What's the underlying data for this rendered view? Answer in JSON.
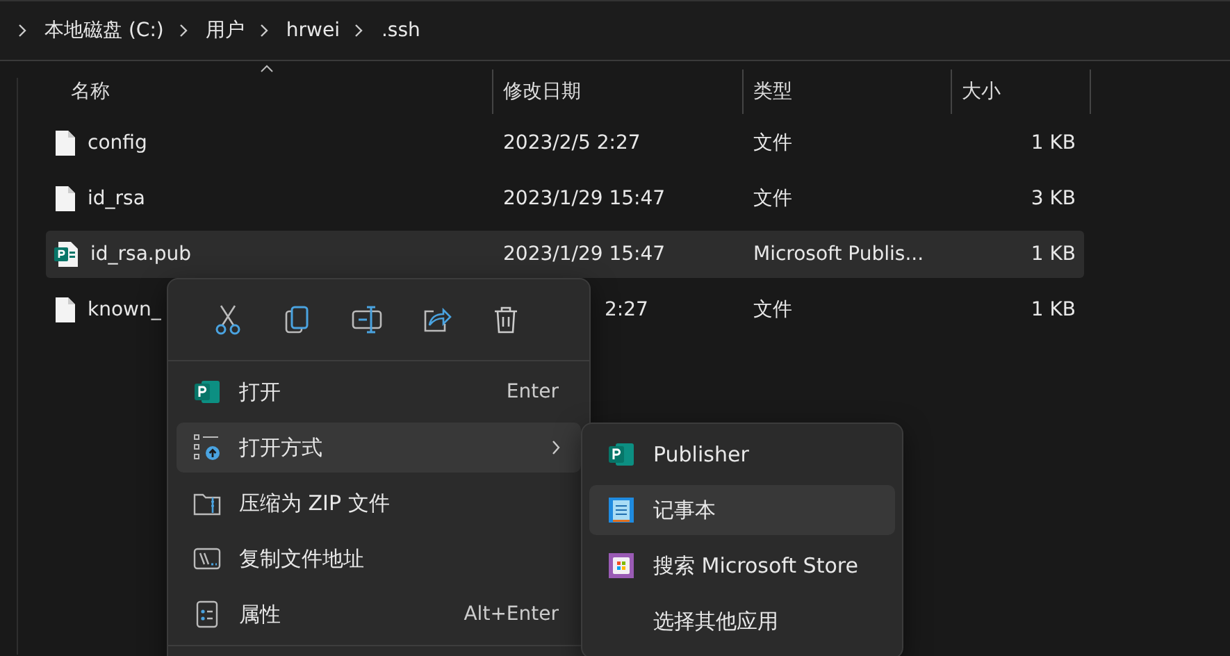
{
  "breadcrumb": [
    "本地磁盘 (C:)",
    "用户",
    "hrwei",
    ".ssh"
  ],
  "columns": [
    {
      "label": "名称",
      "sorted": true
    },
    {
      "label": "修改日期",
      "sorted": false
    },
    {
      "label": "类型",
      "sorted": false
    },
    {
      "label": "大小",
      "sorted": false
    }
  ],
  "rows": [
    {
      "name": "config",
      "date": "2023/2/5 2:27",
      "type": "文件",
      "size": "1 KB",
      "kind": "file",
      "selected": false,
      "covered": false
    },
    {
      "name": "id_rsa",
      "date": "2023/1/29 15:47",
      "type": "文件",
      "size": "3 KB",
      "kind": "file",
      "selected": false,
      "covered": false
    },
    {
      "name": "id_rsa.pub",
      "date": "2023/1/29 15:47",
      "type": "Microsoft Publis...",
      "size": "1 KB",
      "kind": "publisher",
      "selected": true,
      "covered": false
    },
    {
      "name": "known_",
      "date": "2:27",
      "type": "文件",
      "size": "1 KB",
      "kind": "file",
      "selected": false,
      "covered": true
    }
  ],
  "context_menu": {
    "items": [
      {
        "label": "打开",
        "shortcut": "Enter",
        "submenu": false,
        "selected": false
      },
      {
        "label": "打开方式",
        "submenu": true,
        "selected": true
      },
      {
        "label": "压缩为 ZIP 文件",
        "submenu": false,
        "selected": false
      },
      {
        "label": "复制文件地址",
        "submenu": false,
        "selected": false
      },
      {
        "label": "属性",
        "shortcut": "Alt+Enter",
        "submenu": false,
        "selected": false
      }
    ]
  },
  "submenu": [
    {
      "label": "Publisher",
      "selected": false
    },
    {
      "label": "记事本",
      "selected": true
    },
    {
      "label": "搜索 Microsoft Store",
      "selected": false
    },
    {
      "label": "选择其他应用",
      "selected": false
    }
  ]
}
